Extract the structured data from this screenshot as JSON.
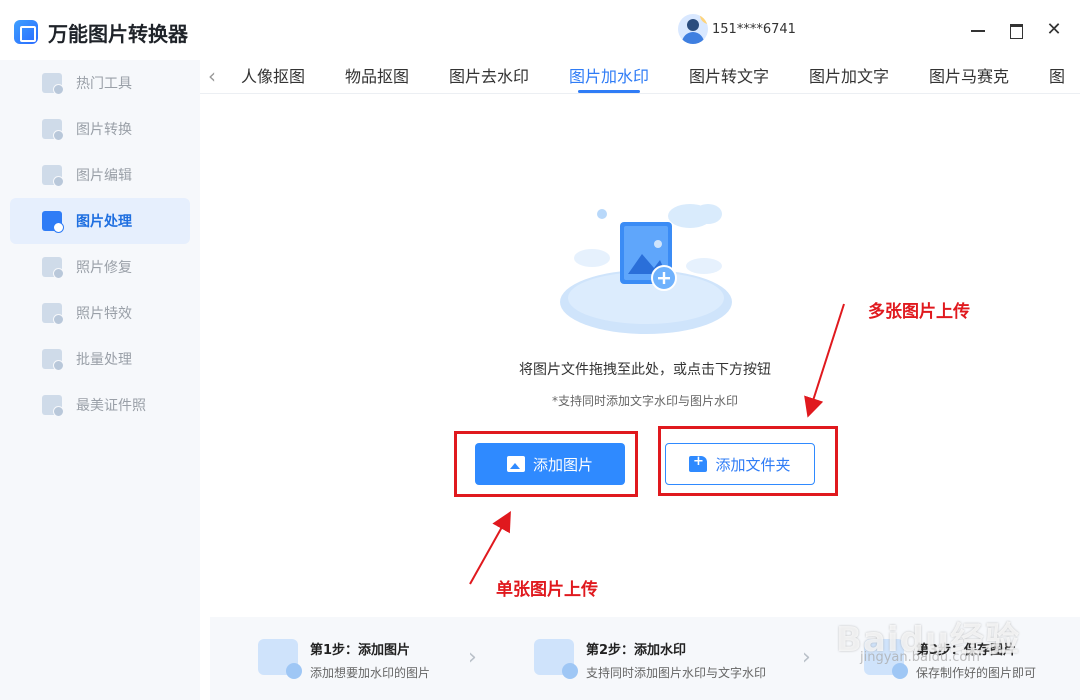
{
  "app": {
    "title": "万能图片转换器"
  },
  "user": {
    "vip_badge": "V",
    "phone": "151****6741"
  },
  "window": {
    "minimize": "",
    "maximize": "",
    "close": "✕"
  },
  "sidebar": {
    "items": [
      {
        "label": "热门工具"
      },
      {
        "label": "图片转换"
      },
      {
        "label": "图片编辑"
      },
      {
        "label": "图片处理"
      },
      {
        "label": "照片修复"
      },
      {
        "label": "照片特效"
      },
      {
        "label": "批量处理"
      },
      {
        "label": "最美证件照"
      }
    ],
    "active_index": 3
  },
  "tabs": {
    "prev": "‹",
    "items": [
      {
        "label": "人像抠图"
      },
      {
        "label": "物品抠图"
      },
      {
        "label": "图片去水印"
      },
      {
        "label": "图片加水印"
      },
      {
        "label": "图片转文字"
      },
      {
        "label": "图片加文字"
      },
      {
        "label": "图片马赛克"
      },
      {
        "label": "图"
      }
    ],
    "active_index": 3
  },
  "main": {
    "drop_hint": "将图片文件拖拽至此处，或点击下方按钮",
    "support_note": "*支持同时添加文字水印与图片水印",
    "add_image_label": "添加图片",
    "add_folder_label": "添加文件夹"
  },
  "annotations": {
    "multi_upload": "多张图片上传",
    "single_upload": "单张图片上传",
    "color": "#e0191e"
  },
  "steps": [
    {
      "title": "第1步：添加图片",
      "desc": "添加想要加水印的图片"
    },
    {
      "title": "第2步：添加水印",
      "desc": "支持同时添加图片水印与文字水印"
    },
    {
      "title": "第3步：保存图片",
      "desc": "保存制作好的图片即可"
    }
  ],
  "watermark": {
    "brand": "Baidu经验",
    "url": "jingyan.baidu.com"
  },
  "colors": {
    "accent": "#2f7cf6",
    "button": "#2f8aff",
    "sidebar_bg": "#f6f8fb"
  }
}
